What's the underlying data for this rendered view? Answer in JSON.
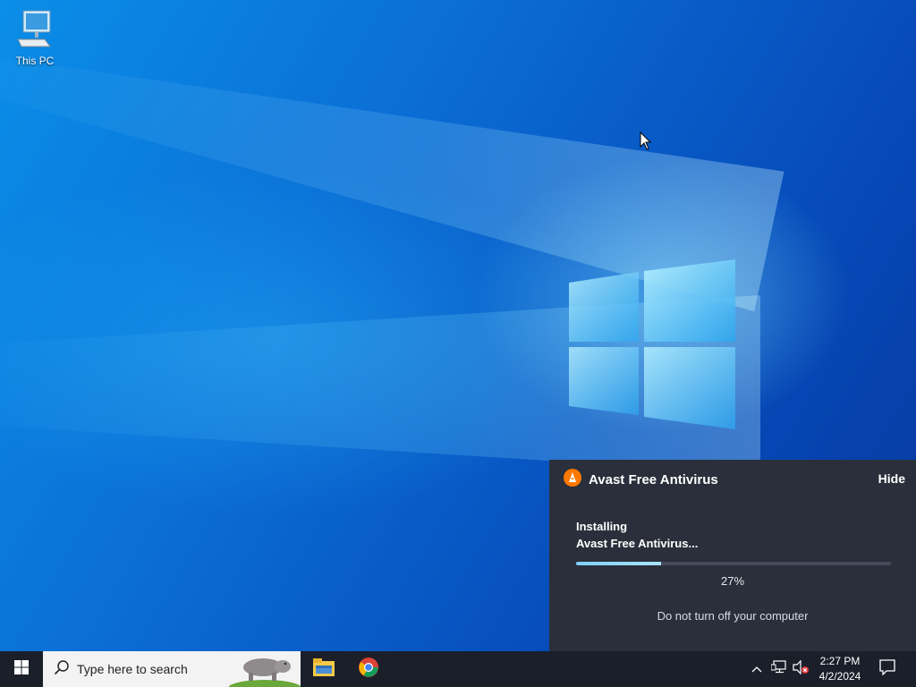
{
  "desktop": {
    "icons": [
      {
        "label": "This PC",
        "icon": "computer-icon"
      }
    ]
  },
  "avast_notification": {
    "title": "Avast Free Antivirus",
    "hide_label": "Hide",
    "status_line1": "Installing",
    "status_line2": "Avast Free Antivirus...",
    "progress": 0.27,
    "progress_text": "27%",
    "warning": "Do not turn off your computer",
    "accent_color": "#ff7800"
  },
  "taskbar": {
    "search_placeholder": "Type here to search",
    "pinned_apps": [
      {
        "name": "File Explorer",
        "icon": "file-explorer-icon"
      },
      {
        "name": "Google Chrome",
        "icon": "chrome-icon"
      }
    ],
    "tray": {
      "icons": [
        "chevron-up-icon",
        "network-icon",
        "volume-muted-icon"
      ],
      "time": "2:27 PM",
      "date": "4/2/2024",
      "notification_icon": "action-center-icon"
    }
  },
  "colors": {
    "taskbar": "#1a1f2a",
    "panel": "#2a2f3b",
    "progress_fill": "#7fd0ff"
  }
}
